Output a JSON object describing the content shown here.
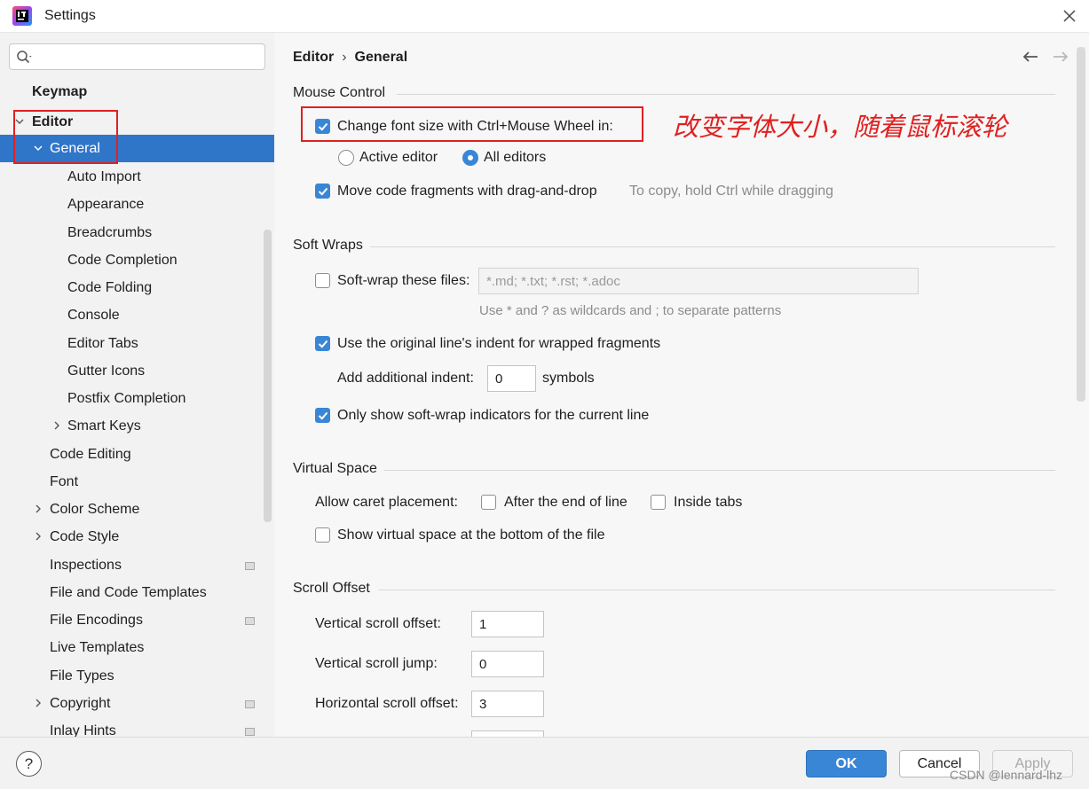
{
  "window": {
    "title": "Settings"
  },
  "search": {
    "placeholder": ""
  },
  "sidebar": {
    "items": [
      {
        "label": "Keymap"
      },
      {
        "label": "Editor"
      },
      {
        "label": "General"
      },
      {
        "label": "Auto Import"
      },
      {
        "label": "Appearance"
      },
      {
        "label": "Breadcrumbs"
      },
      {
        "label": "Code Completion"
      },
      {
        "label": "Code Folding"
      },
      {
        "label": "Console"
      },
      {
        "label": "Editor Tabs"
      },
      {
        "label": "Gutter Icons"
      },
      {
        "label": "Postfix Completion"
      },
      {
        "label": "Smart Keys"
      },
      {
        "label": "Code Editing"
      },
      {
        "label": "Font"
      },
      {
        "label": "Color Scheme"
      },
      {
        "label": "Code Style"
      },
      {
        "label": "Inspections"
      },
      {
        "label": "File and Code Templates"
      },
      {
        "label": "File Encodings"
      },
      {
        "label": "Live Templates"
      },
      {
        "label": "File Types"
      },
      {
        "label": "Copyright"
      },
      {
        "label": "Inlay Hints"
      }
    ]
  },
  "breadcrumb": {
    "parent": "Editor",
    "sep": "›",
    "current": "General"
  },
  "mouse_control": {
    "title": "Mouse Control",
    "change_font_size": {
      "label": "Change font size with Ctrl+Mouse Wheel in:",
      "checked": true
    },
    "active_editor": {
      "label": "Active editor",
      "selected": false
    },
    "all_editors": {
      "label": "All editors",
      "selected": true
    },
    "move_code": {
      "label": "Move code fragments with drag-and-drop",
      "checked": true
    },
    "move_code_hint": "To copy, hold Ctrl while dragging",
    "annotation": "改变字体大小，随着鼠标滚轮"
  },
  "soft_wraps": {
    "title": "Soft Wraps",
    "soft_wrap_files": {
      "label": "Soft-wrap these files:",
      "checked": false
    },
    "patterns_value": "*.md; *.txt; *.rst; *.adoc",
    "patterns_hint": "Use * and ? as wildcards and ; to separate patterns",
    "original_indent": {
      "label": "Use the original line's indent for wrapped fragments",
      "checked": true
    },
    "additional_indent_label": "Add additional indent:",
    "additional_indent_value": "0",
    "symbols_label": "symbols",
    "only_show_indicators": {
      "label": "Only show soft-wrap indicators for the current line",
      "checked": true
    }
  },
  "virtual_space": {
    "title": "Virtual Space",
    "allow_caret_label": "Allow caret placement:",
    "after_end_of_line": {
      "label": "After the end of line",
      "checked": false
    },
    "inside_tabs": {
      "label": "Inside tabs",
      "checked": false
    },
    "show_virtual_space": {
      "label": "Show virtual space at the bottom of the file",
      "checked": false
    }
  },
  "scroll_offset": {
    "title": "Scroll Offset",
    "vertical_offset": {
      "label": "Vertical scroll offset:",
      "value": "1"
    },
    "vertical_jump": {
      "label": "Vertical scroll jump:",
      "value": "0"
    },
    "horizontal_offset": {
      "label": "Horizontal scroll offset:",
      "value": "3"
    }
  },
  "footer": {
    "help_label": "?",
    "ok_label": "OK",
    "cancel_label": "Cancel",
    "apply_label": "Apply",
    "watermark": "CSDN @lennard-lhz"
  },
  "colors": {
    "accent": "#3a86d6",
    "selection": "#2f76c9",
    "annotation_red": "#e02020"
  }
}
